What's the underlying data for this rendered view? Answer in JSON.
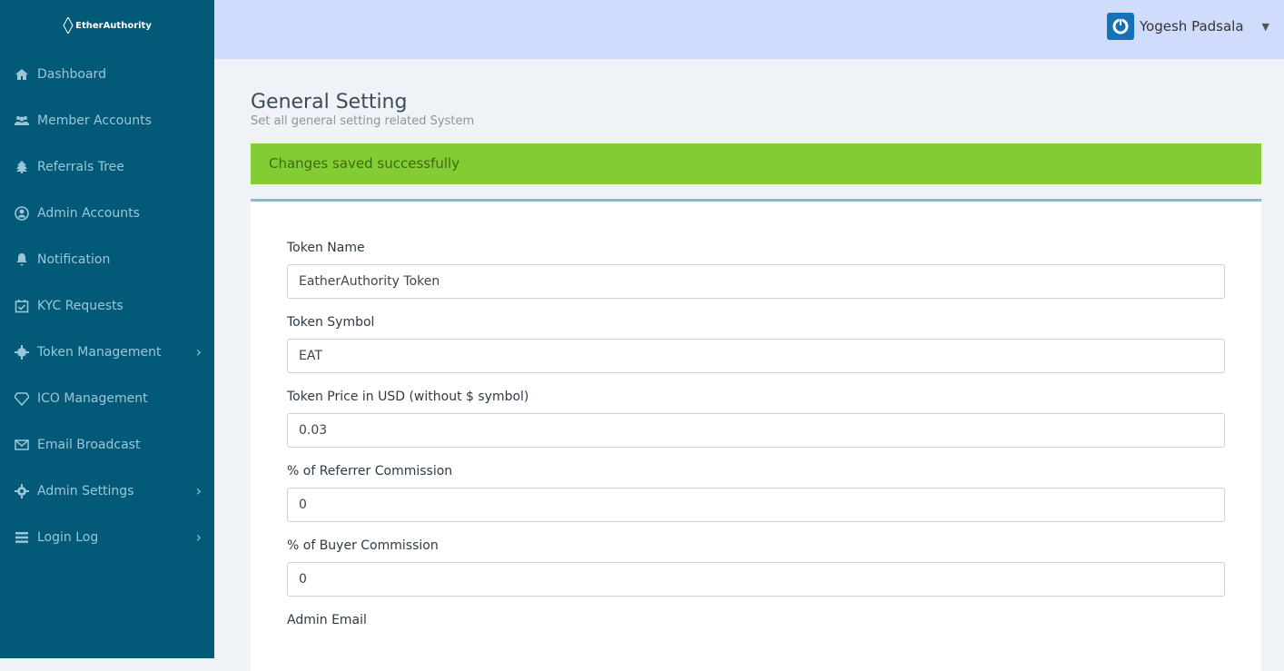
{
  "logo": {
    "text": "EtherAuthority"
  },
  "sidebar": {
    "items": [
      {
        "label": "Dashboard",
        "icon": "home-icon"
      },
      {
        "label": "Member Accounts",
        "icon": "users-icon"
      },
      {
        "label": "Referrals Tree",
        "icon": "tree-icon"
      },
      {
        "label": "Admin Accounts",
        "icon": "user-circle-icon"
      },
      {
        "label": "Notification",
        "icon": "bell-icon"
      },
      {
        "label": "KYC Requests",
        "icon": "calendar-check-icon"
      },
      {
        "label": "Token Management",
        "icon": "cog-icon",
        "submenu": true
      },
      {
        "label": "ICO Management",
        "icon": "diamond-icon"
      },
      {
        "label": "Email Broadcast",
        "icon": "envelope-icon"
      },
      {
        "label": "Admin Settings",
        "icon": "gear-icon",
        "submenu": true
      },
      {
        "label": "Login Log",
        "icon": "list-icon",
        "submenu": true
      }
    ]
  },
  "header": {
    "user_name": "Yogesh Padsala"
  },
  "page": {
    "title": "General Setting",
    "subtitle": "Set all general setting related System",
    "alert": "Changes saved successfully"
  },
  "form": {
    "fields": [
      {
        "label": "Token Name",
        "value": "EatherAuthority Token"
      },
      {
        "label": "Token Symbol",
        "value": "EAT"
      },
      {
        "label": "Token Price in USD (without $ symbol)",
        "value": "0.03"
      },
      {
        "label": "% of Referrer Commission",
        "value": "0"
      },
      {
        "label": "% of Buyer Commission",
        "value": "0"
      },
      {
        "label": "Admin Email"
      }
    ]
  },
  "colors": {
    "sidebar": "#035a78",
    "topbar": "#cfdcfb",
    "alert": "#84cc34",
    "accent": "#78bfde"
  }
}
